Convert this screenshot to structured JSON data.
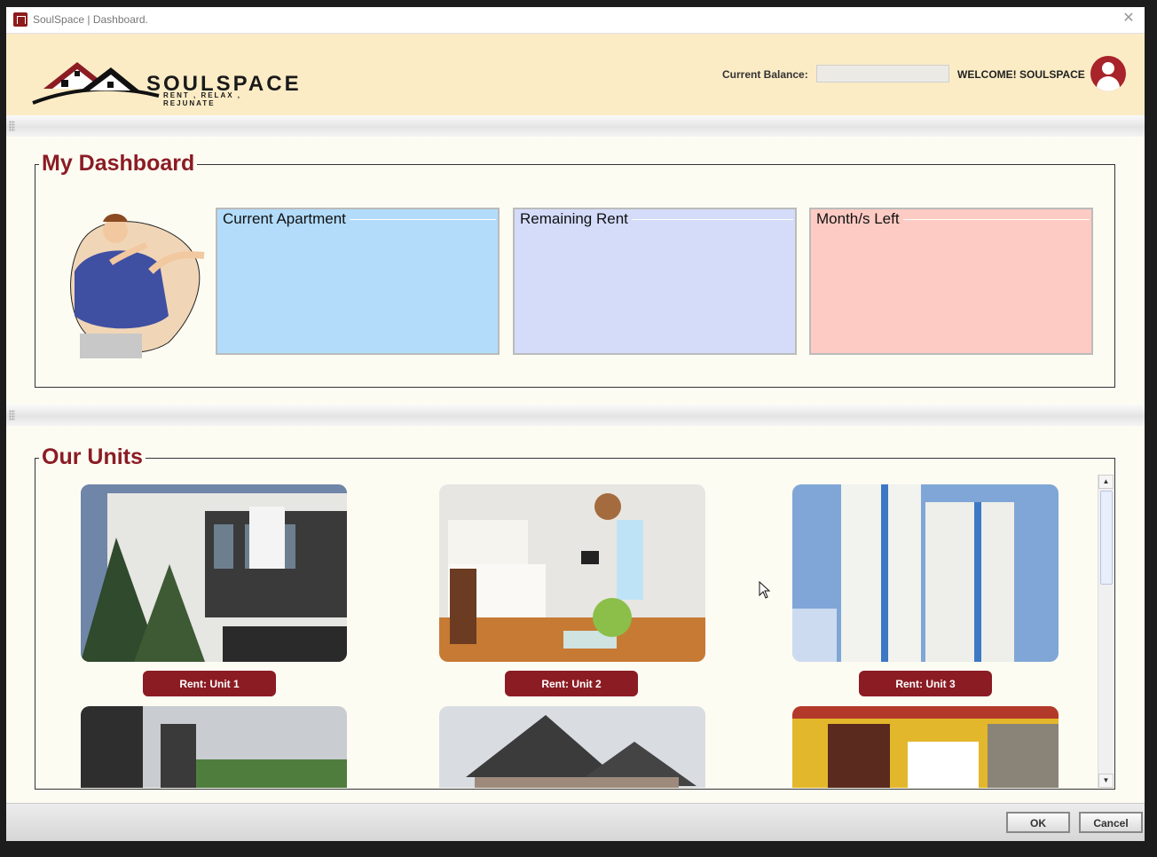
{
  "window": {
    "title": "SoulSpace | Dashboard."
  },
  "header": {
    "brand": "SOULSPACE",
    "tagline": "RENT , RELAX , REJUNATE",
    "balance_label": "Current Balance:",
    "balance_value": "",
    "welcome": "WELCOME!  SOULSPACE"
  },
  "dashboard": {
    "title": "My Dashboard",
    "cards": [
      {
        "label": "Current Apartment",
        "value": "",
        "color": "#b2dcfa"
      },
      {
        "label": "Remaining Rent",
        "value": "",
        "color": "#d4dcfa"
      },
      {
        "label": "Month/s Left",
        "value": "",
        "color": "#fdcbc4"
      }
    ]
  },
  "units": {
    "title": "Our Units",
    "rent_buttons": [
      "Rent: Unit 1",
      "Rent: Unit 2",
      "Rent: Unit 3"
    ]
  },
  "footer": {
    "ok": "OK",
    "cancel": "Cancel"
  },
  "colors": {
    "accent": "#8b1c24",
    "header_bg": "#fcecc6",
    "page_bg": "#fdfcf3"
  }
}
